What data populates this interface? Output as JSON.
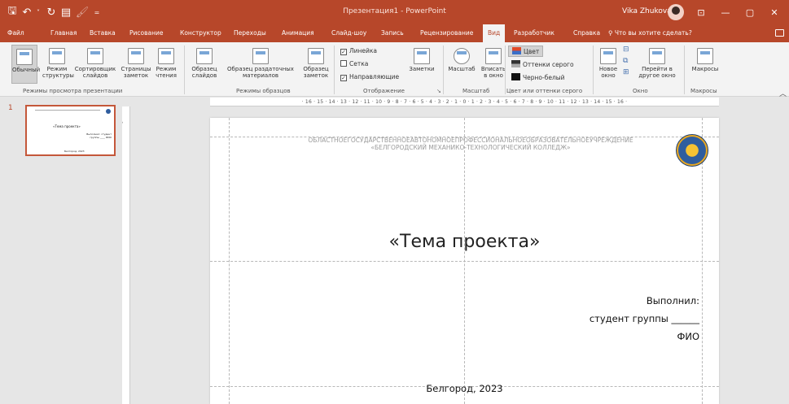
{
  "titlebar": {
    "title": "Презентация1 - PowerPoint",
    "user": "Vika Zhukova",
    "bg_color": "#b7472a"
  },
  "tabs": [
    "Файл",
    "Главная",
    "Вставка",
    "Рисование",
    "Конструктор",
    "Переходы",
    "Анимация",
    "Слайд-шоу",
    "Запись",
    "Рецензирование",
    "Вид",
    "Разработчик",
    "Справка"
  ],
  "active_tab": "Вид",
  "tellme": "Что вы хотите сделать?",
  "ribbon": {
    "views": [
      {
        "label": "Обычный"
      },
      {
        "label": "Режим структуры"
      },
      {
        "label": "Сортировщик слайдов"
      },
      {
        "label": "Страницы заметок"
      },
      {
        "label": "Режим чтения"
      }
    ],
    "group_views": "Режимы просмотра презентации",
    "masters": [
      {
        "label": "Образец слайдов"
      },
      {
        "label": "Образец раздаточных материалов"
      },
      {
        "label": "Образец заметок"
      }
    ],
    "group_masters": "Режимы образцов",
    "show": {
      "ruler": "Линейка",
      "grid": "Сетка",
      "guides": "Направляющие",
      "notes": "Заметки"
    },
    "group_show": "Отображение",
    "zoom": "Масштаб",
    "fit": "Вписать в окно",
    "group_zoom": "Масштаб",
    "color": "Цвет",
    "grayscale": "Оттенки серого",
    "bw": "Черно-белый",
    "group_color": "Цвет или оттенки серого",
    "new_window": "Новое окно",
    "switch_window": "Перейти в другое окно",
    "group_window": "Окно",
    "macros": "Макросы",
    "group_macros": "Макросы"
  },
  "thumbnail": {
    "number": "1",
    "title": "«Тема проекта»",
    "right": "Выполнил: студент группы ____ ФИО",
    "city": "Белгород, 2023"
  },
  "ruler": {
    "h": "· 16 · 15 · 14 · 13 · 12 · 11 · 10 · 9 · 8 · 7 · 6 · 5 · 4 · 3 · 2 · 1 · 0 · 1 · 2 · 3 · 4 · 5 · 6 · 7 · 8 · 9 · 10 · 11 · 12 · 13 · 14 · 15 · 16 ·"
  },
  "slide": {
    "header_line1": "ОБЛАСТНОЕГОСУДАРСТВЕННОЕАВТОНОМНОЕПРОФЕССИОНАЛЬНОЕОБРАЗОВАТЕЛЬНОЕУЧРЕЖДЕНИЕ",
    "header_line2": "«БЕЛГОРОДСКИЙ МЕХАНИКО-ТЕХНОЛОГИЧЕСКИЙ КОЛЛЕДЖ»",
    "title": "«Тема проекта»",
    "done": "Выполнил:",
    "group": "студент группы ______",
    "fio": "ФИО",
    "city": "Белгород, 2023"
  }
}
